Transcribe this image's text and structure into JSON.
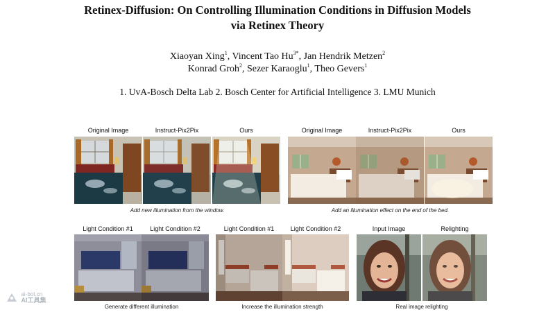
{
  "paper": {
    "title_line1": "Retinex-Diffusion: On Controlling Illumination Conditions in Diffusion Models",
    "title_line2": "via Retinex Theory",
    "authors": [
      {
        "name": "Xiaoyan Xing",
        "sup": "1"
      },
      {
        "name": "Vincent Tao Hu",
        "sup": "3*"
      },
      {
        "name": "Jan Hendrik Metzen",
        "sup": "2"
      },
      {
        "name": "Konrad Groh",
        "sup": "2"
      },
      {
        "name": "Sezer Karaoglu",
        "sup": "1"
      },
      {
        "name": "Theo Gevers",
        "sup": "1"
      }
    ],
    "affiliations": "1. UvA-Bosch Delta Lab 2. Bosch Center for Artificial Intelligence 3. LMU Munich"
  },
  "figure": {
    "top_left": {
      "labels": [
        "Original Image",
        "Instruct-Pix2Pix",
        "Ours"
      ],
      "caption": "Add new illumination from the window."
    },
    "top_right": {
      "labels": [
        "Original Image",
        "Instruct-Pix2Pix",
        "Ours"
      ],
      "caption": "Add an illumination effect on the end of the bed."
    },
    "bottom_left": {
      "labels": [
        "Light Condition #1",
        "Light Condition #2"
      ],
      "caption": "Generate different illumination"
    },
    "bottom_middle": {
      "labels": [
        "Light Condition #1",
        "Light Condition #2"
      ],
      "caption": "Increase the illumination strength"
    },
    "bottom_right": {
      "labels": [
        "Input Image",
        "Relighting"
      ],
      "caption": "Real image relighting"
    }
  },
  "watermark": {
    "line1": "ai-bot.cn",
    "line2": "AI工具集"
  }
}
